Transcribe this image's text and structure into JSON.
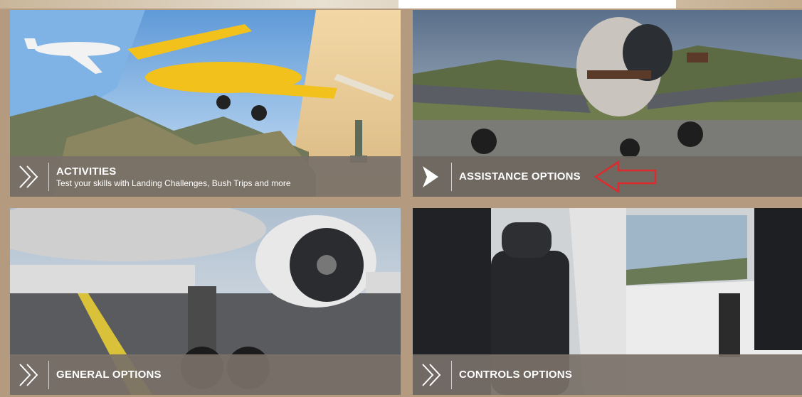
{
  "tiles": [
    {
      "title": "ACTIVITIES",
      "subtitle": "Test your skills with Landing Challenges, Bush Trips and more"
    },
    {
      "title": "ASSISTANCE OPTIONS",
      "subtitle": ""
    },
    {
      "title": "GENERAL OPTIONS",
      "subtitle": ""
    },
    {
      "title": "CONTROLS OPTIONS",
      "subtitle": ""
    }
  ],
  "annotation": {
    "arrow_color": "#e0292b",
    "arrow_target": "assistance-options"
  }
}
